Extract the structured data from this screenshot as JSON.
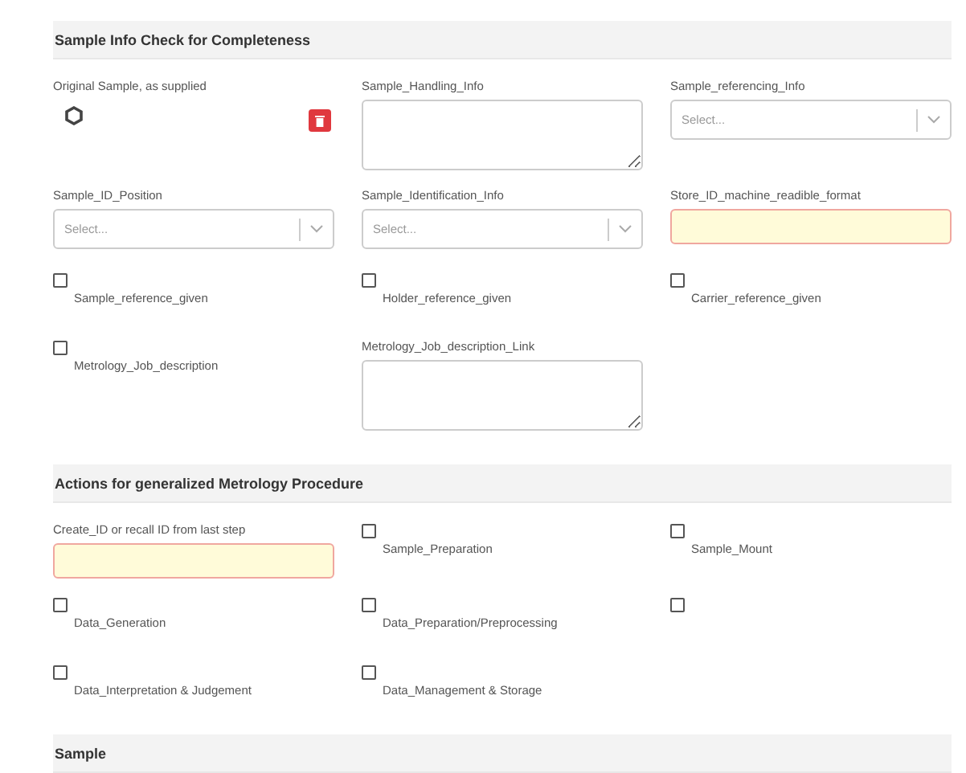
{
  "sections": [
    {
      "title": "Sample Info Check for Completeness",
      "fields": [
        {
          "kind": "sample",
          "label": "Original Sample, as supplied"
        },
        {
          "kind": "textarea",
          "label": "Sample_Handling_Info"
        },
        {
          "kind": "select",
          "label": "Sample_referencing_Info",
          "placeholder": "Select..."
        },
        {
          "kind": "select",
          "label": "Sample_ID_Position",
          "placeholder": "Select..."
        },
        {
          "kind": "select",
          "label": "Sample_Identification_Info",
          "placeholder": "Select..."
        },
        {
          "kind": "input",
          "label": "Store_ID_machine_readible_format",
          "required": true
        },
        {
          "kind": "checkbox",
          "label": "Sample_reference_given",
          "checked": false
        },
        {
          "kind": "checkbox",
          "label": "Holder_reference_given",
          "checked": false
        },
        {
          "kind": "checkbox",
          "label": "Carrier_reference_given",
          "checked": false
        },
        {
          "kind": "checkbox",
          "label": "Metrology_Job_description",
          "checked": false
        },
        {
          "kind": "textarea",
          "label": "Metrology_Job_description_Link"
        }
      ]
    },
    {
      "title": "Actions for generalized Metrology Procedure",
      "fields": [
        {
          "kind": "input",
          "label": "Create_ID or recall ID from last step",
          "required": true
        },
        {
          "kind": "checkbox",
          "label": "Sample_Preparation",
          "checked": false
        },
        {
          "kind": "checkbox",
          "label": "Sample_Mount",
          "checked": false
        },
        {
          "kind": "checkbox",
          "label": "Data_Generation",
          "checked": false
        },
        {
          "kind": "checkbox",
          "label": "Data_Preparation/Preprocessing",
          "checked": false
        },
        {
          "kind": "checkbox",
          "checked": false
        },
        {
          "kind": "checkbox",
          "label": "Data_Interpretation & Judgement",
          "checked": false
        },
        {
          "kind": "checkbox",
          "label": "Data_Management & Storage",
          "checked": false
        }
      ]
    },
    {
      "title": "Sample"
    }
  ]
}
